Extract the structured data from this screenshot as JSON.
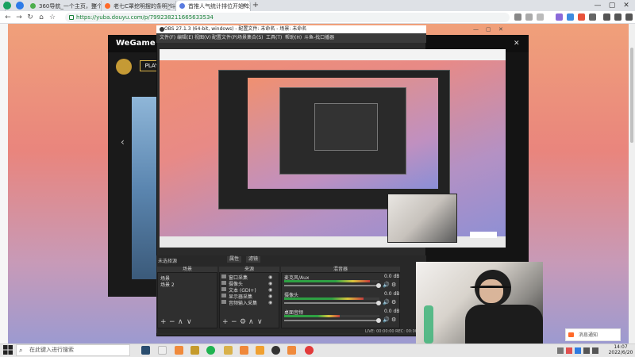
{
  "browser": {
    "tabs": [
      {
        "label": "360导航_一个主页，整个世界",
        "active": false,
        "color": "#4cae4c"
      },
      {
        "label": "老七C罩挖明摆的条明_斗鱼分",
        "active": false,
        "color": "#ff6a2a"
      },
      {
        "label": "首推人气统计排位开始阵型",
        "active": true,
        "color": "#5a7be0"
      }
    ],
    "new_tab": "+",
    "url": "https://yuba.douyu.com/p/799238211665633534",
    "window_controls": [
      "—",
      "▢",
      "✕"
    ]
  },
  "wegame": {
    "logo": "WeGame",
    "play": "PLAY"
  },
  "obs": {
    "title": "OBS 27.1.3 (64-bit, windows) - 配置文件: 未命名 - 场景: 未命名",
    "menu": [
      "文件(F)",
      "编辑(E)",
      "视图(V)",
      "配置文件(P)",
      "场景集合(S)",
      "工具(T)",
      "帮助(H)",
      "斗鱼-找口播器"
    ],
    "status_label": "未选择源",
    "props_label": "属性",
    "filters_label": "滤镜",
    "scenes_header": "场景",
    "scenes": [
      "场景",
      "场景 2"
    ],
    "sources_header": "来源",
    "sources": [
      "窗口采集",
      "摄像头",
      "文本 (GDI+)",
      "显示器采集",
      "音频输入采集"
    ],
    "mixer_header": "混音器",
    "mixer": [
      {
        "name": "麦克风/Aux",
        "db": "0.0 dB"
      },
      {
        "name": "摄像头",
        "db": "0.0 dB"
      },
      {
        "name": "桌面音频",
        "db": "0.0 dB"
      }
    ],
    "footer": "LIVE: 00:00:00  REC: 00:00:00  CPU: 3.2%, 30.00 fps",
    "dock_buttons": [
      "+",
      "−",
      "∧",
      "∨"
    ]
  },
  "notice": {
    "label": "消息通知"
  },
  "taskbar": {
    "search_placeholder": "在此键入进行搜索",
    "time": "14:07",
    "date": "2022/6/20"
  }
}
